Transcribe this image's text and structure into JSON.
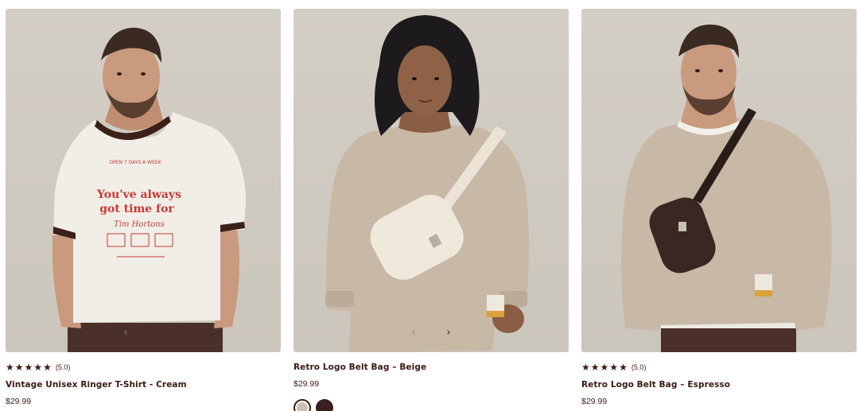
{
  "products": [
    {
      "name": "Vintage Unisex Ringer T-Shirt - Cream",
      "price": "$29.99",
      "rating_value": "(5.0)",
      "stars": [
        "★",
        "★",
        "★",
        "★",
        "★"
      ],
      "nav": {
        "prev": "‹",
        "next": "›"
      },
      "shirt_print": [
        "OPEN 7 DAYS A WEEK",
        "You've always",
        "got time for",
        "Tim Hortons"
      ]
    },
    {
      "name": "Retro Logo Belt Bag – Beige",
      "price": "$29.99",
      "nav": {
        "prev": "‹",
        "next": "›"
      },
      "swatches": [
        {
          "color": "#cbc3b5",
          "selected": true
        },
        {
          "color": "#3b1e1e",
          "selected": false
        }
      ]
    },
    {
      "name": "Retro Logo Belt Bag – Espresso",
      "price": "$29.99",
      "rating_value": "(5.0)",
      "stars": [
        "★",
        "★",
        "★",
        "★",
        "★"
      ]
    }
  ],
  "colors": {
    "text": "#3a1a12",
    "image_bg": "#cfcac1",
    "tshirt": "#f1eee8",
    "ringer_trim": "#3b2118",
    "print_red": "#c63a35",
    "sweater": "#c8b8a6",
    "bag_beige": "#efe9dc",
    "bag_espresso": "#3a2622",
    "pants": "#4a3028"
  }
}
